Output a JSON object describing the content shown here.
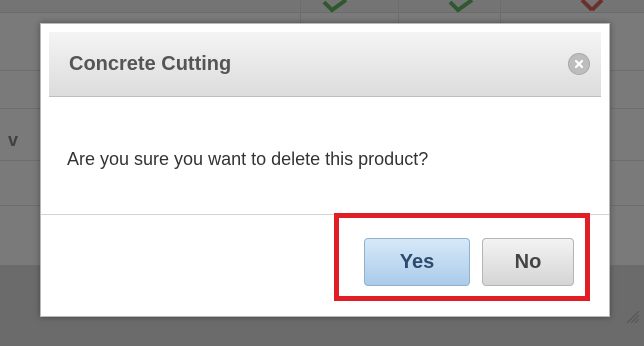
{
  "dialog": {
    "title": "Concrete Cutting",
    "message": "Are you sure you want to delete this product?",
    "yes_label": "Yes",
    "no_label": "No",
    "close_icon": "close-icon"
  },
  "background": {
    "cell_text": "v"
  },
  "colors": {
    "highlight": "#e11e26",
    "yes_button": "#aacbea",
    "no_button": "#d5d5d5",
    "overlay": "#282828"
  }
}
